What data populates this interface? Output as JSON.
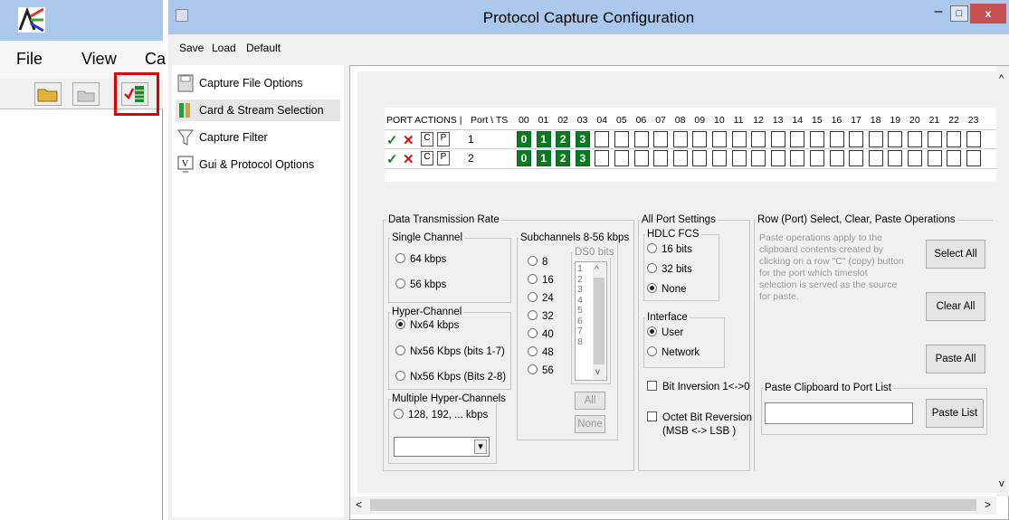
{
  "parent": {
    "menu": [
      "File",
      "View",
      "Ca"
    ]
  },
  "dialog": {
    "title": "Protocol Capture Configuration",
    "min": "–",
    "max": "□",
    "close": "x",
    "menu": [
      "Save",
      "Load",
      "Default"
    ]
  },
  "nav": [
    {
      "label": "Capture File Options",
      "icon": "floppy-icon"
    },
    {
      "label": "Card & Stream Selection",
      "icon": "card-icon"
    },
    {
      "label": "Capture Filter",
      "icon": "funnel-icon"
    },
    {
      "label": "Gui & Protocol Options",
      "icon": "monitor-icon"
    }
  ],
  "grid": {
    "header_actions": "PORT ACTIONS |",
    "header_port": "Port \\ TS",
    "timeslots": [
      "00",
      "01",
      "02",
      "03",
      "04",
      "05",
      "06",
      "07",
      "08",
      "09",
      "10",
      "11",
      "12",
      "13",
      "14",
      "15",
      "16",
      "17",
      "18",
      "19",
      "20",
      "21",
      "22",
      "23"
    ],
    "rows": [
      {
        "port": "1",
        "active": [
          "0",
          "1",
          "2",
          "3"
        ]
      },
      {
        "port": "2",
        "active": [
          "0",
          "1",
          "2",
          "3"
        ]
      }
    ],
    "action_icons": [
      "✓",
      "✕",
      "C",
      "P"
    ]
  },
  "rate": {
    "title": "Data Transmission Rate",
    "single_title": "Single Channel",
    "single": [
      "64 kbps",
      "56 kbps"
    ],
    "hyper_title": "Hyper-Channel",
    "hyper": [
      "Nx64 kbps",
      "Nx56 Kbps (bits 1-7)",
      "Nx56 Kbps (Bits 2-8)"
    ],
    "hyper_selected": 0,
    "multi_title": "Multiple Hyper-Channels",
    "multi": "128, 192, ... kbps",
    "dropdown_arrow": "▾"
  },
  "sub": {
    "title": "Subchannels 8-56 kbps",
    "options": [
      "8",
      "16",
      "24",
      "32",
      "40",
      "48",
      "56"
    ],
    "ds0_title": "DS0 bits",
    "bits": [
      "1",
      "2",
      "3",
      "4",
      "5",
      "6",
      "7",
      "8"
    ],
    "all": "All",
    "none": "None"
  },
  "allport": {
    "title": "All Port Settings",
    "hdlc_title": "HDLC FCS",
    "hdlc": [
      "16 bits",
      "32 bits",
      "None"
    ],
    "hdlc_selected": 2,
    "iface_title": "Interface",
    "iface": [
      "User",
      "Network"
    ],
    "iface_selected": 0,
    "bit_inversion": "Bit Inversion 1<->0",
    "octet_reversal": "Octet Bit Reversion",
    "octet_reversal_sub": "(MSB <-> LSB )"
  },
  "rowops": {
    "title": "Row (Port) Select, Clear, Paste Operations",
    "note": [
      "Paste operations apply to the",
      "clipboard contents created by",
      "clicking on a row \"C\" (copy) button",
      "for the port which timeslot",
      "selection is served as the source",
      "for paste."
    ],
    "select_all": "Select All",
    "clear_all": "Clear All",
    "paste_all": "Paste All",
    "paste_title": "Paste Clipboard to Port List",
    "paste_list": "Paste List"
  },
  "scroll": {
    "left": "<",
    "right": ">",
    "up": "^",
    "down": "v"
  }
}
